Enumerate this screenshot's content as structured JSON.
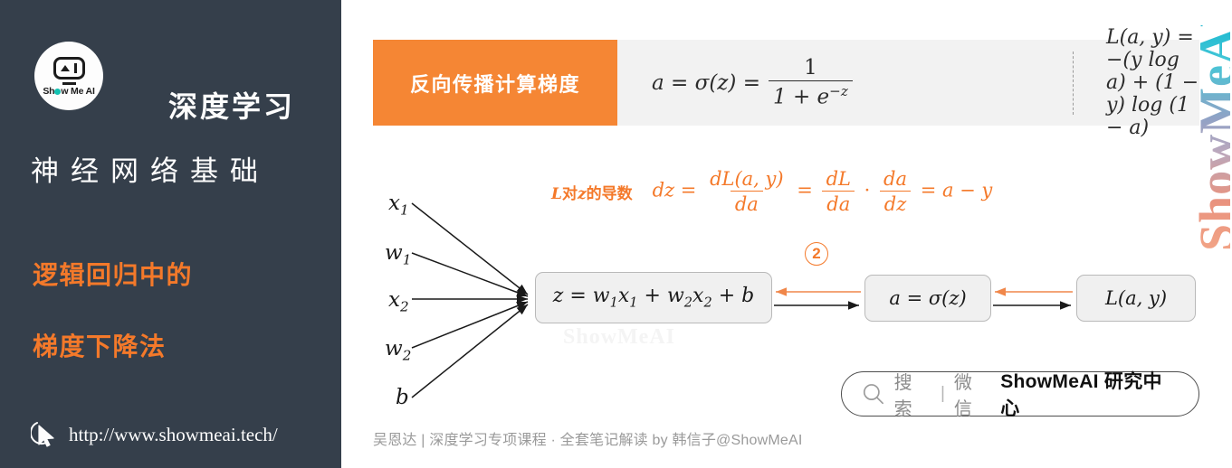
{
  "sidebar": {
    "logo": {
      "icon": "showmeai-robot-logo",
      "text_left": "Sh",
      "text_right": "w Me AI"
    },
    "title_line1": "深度学习",
    "title_line2": "神经网络基础",
    "subtitle_line1": "逻辑回归中的",
    "subtitle_line2": "梯度下降法",
    "url": "http://www.showmeai.tech/",
    "cursor_icon": "mouse-cursor-icon",
    "bg_color": "#353f4b",
    "accent_color": "#F4792A"
  },
  "header": {
    "tag_label": "反向传播计算梯度",
    "tag_color": "#F58634",
    "banner_bg": "#f2f2f2",
    "formula_sigmoid": {
      "lhs": "a = σ(z) =",
      "numerator": "1",
      "denominator": "1 + e⁻ᶻ"
    },
    "formula_loss": "L(a, y) = −(y log a) + (1 − y) log (1 − a)"
  },
  "derivative": {
    "label_prefix": "L",
    "label_mid": "对",
    "label_var": "z",
    "label_suffix": "的导数",
    "expr_lhs": "dz =",
    "frac1_num": "dL(a, y)",
    "frac1_den": "da",
    "eq1": "=",
    "frac2_num": "dL",
    "frac2_den": "da",
    "dot": "·",
    "frac3_num": "da",
    "frac3_den": "dz",
    "eq2": "= a − y",
    "color": "#F4792A"
  },
  "graph": {
    "inputs": [
      {
        "label": "x",
        "sub": "1"
      },
      {
        "label": "w",
        "sub": "1"
      },
      {
        "label": "x",
        "sub": "2"
      },
      {
        "label": "w",
        "sub": "2"
      },
      {
        "label": "b",
        "sub": ""
      }
    ],
    "node_z": "z = w₁x₁ + w₂x₂ + b",
    "node_a": "a = σ(z)",
    "node_l": "L(a, y)",
    "step_badge": "2",
    "forward_arrow_color": "#1a1a1a",
    "backward_arrow_color": "#F0874A",
    "watermark_center": "ShowMeAI"
  },
  "search_pill": {
    "icon": "search-icon",
    "label": "搜索",
    "separator": "|",
    "channel": "微信",
    "brand": "ShowMeAI 研究中心"
  },
  "footer": {
    "caption": "吴恩达 | 深度学习专项课程 · 全套笔记解读  by 韩信子@ShowMeAI"
  },
  "watermark_right": "ShowMeAI"
}
